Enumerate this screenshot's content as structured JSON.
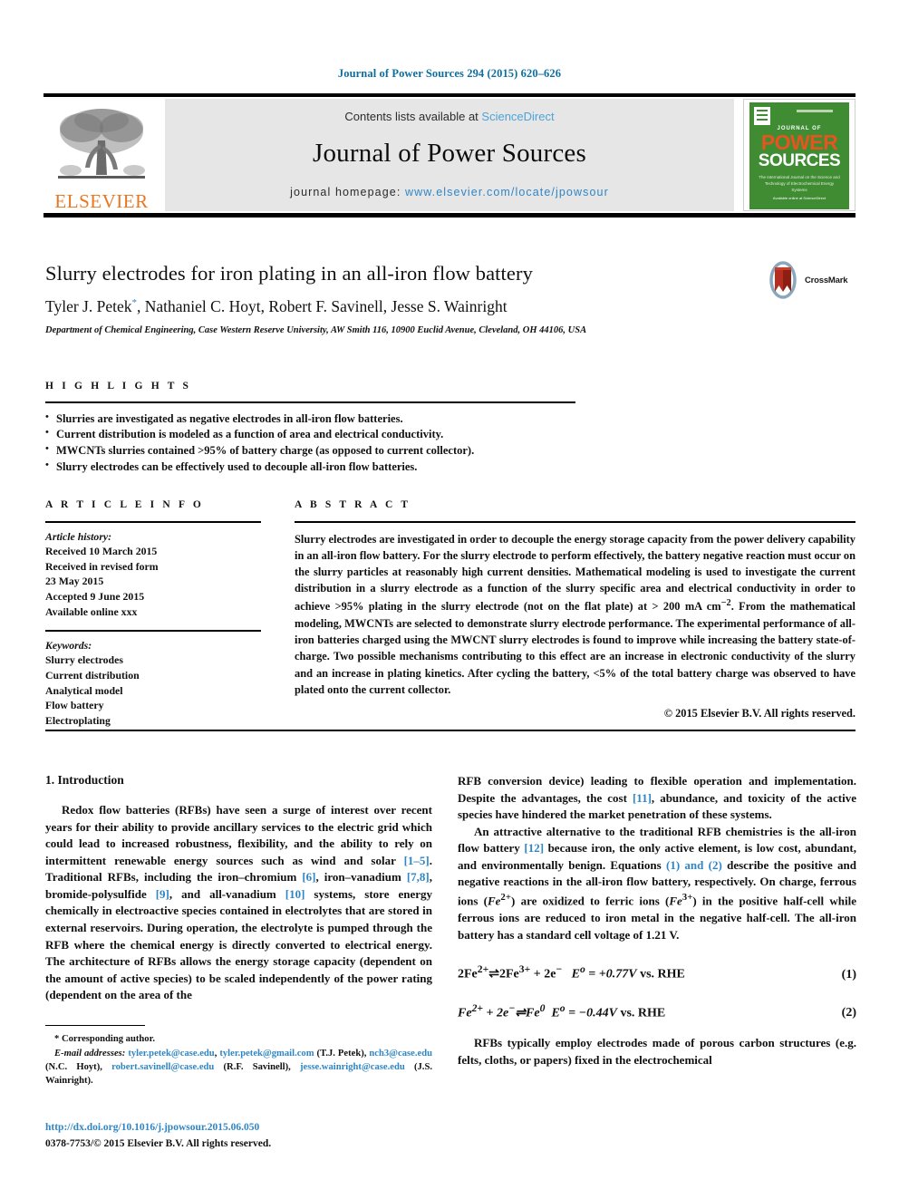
{
  "running_head": "Journal of Power Sources 294 (2015) 620–626",
  "masthead": {
    "contents_prefix": "Contents lists available at ",
    "sciencedirect": "ScienceDirect",
    "journal_title": "Journal of Power Sources",
    "homepage_prefix": "journal homepage: ",
    "homepage_url": "www.elsevier.com/locate/jpowsour",
    "publisher_wordmark": "ELSEVIER",
    "cover": {
      "journal_of": "JOURNAL OF",
      "power": "POWER",
      "sources": "SOURCES",
      "subtitle": "The International Journal on the Science and Technology of Electrochemical Energy Systems",
      "footer": "Available online at\nScienceDirect"
    },
    "accent_link_color": "#4ea3d8",
    "elsevier_orange": "#E87722",
    "cover_green": "#3f8c33"
  },
  "article": {
    "title": "Slurry electrodes for iron plating in an all-iron flow battery",
    "authors": "Tyler J. Petek, Nathaniel C. Hoyt, Robert F. Savinell, Jesse S. Wainright",
    "corresponding_marker": "*",
    "affiliation": "Department of Chemical Engineering, Case Western Reserve University, AW Smith 116, 10900 Euclid Avenue, Cleveland, OH 44106, USA",
    "crossmark_label": "CrossMark"
  },
  "highlights": {
    "heading": "H I G H L I G H T S",
    "items": [
      "Slurries are investigated as negative electrodes in all-iron flow batteries.",
      "Current distribution is modeled as a function of area and electrical conductivity.",
      "MWCNTs slurries contained >95% of battery charge (as opposed to current collector).",
      "Slurry electrodes can be effectively used to decouple all-iron flow batteries."
    ]
  },
  "article_info": {
    "heading": "A R T I C L E  I N F O",
    "history_label": "Article history:",
    "history": [
      "Received 10 March 2015",
      "Received in revised form",
      "23 May 2015",
      "Accepted 9 June 2015",
      "Available online xxx"
    ],
    "keywords_label": "Keywords:",
    "keywords": [
      "Slurry electrodes",
      "Current distribution",
      "Analytical model",
      "Flow battery",
      "Electroplating"
    ]
  },
  "abstract": {
    "heading": "A B S T R A C T",
    "text_part1": "Slurry electrodes are investigated in order to decouple the energy storage capacity from the power delivery capability in an all-iron flow battery. For the slurry electrode to perform effectively, the battery negative reaction must occur on the slurry particles at reasonably high current densities. Mathematical modeling is used to investigate the current distribution in a slurry electrode as a function of the slurry specific area and electrical conductivity in order to achieve >95% plating in the slurry electrode (not on the flat plate) at > 200 mA cm",
    "superscript1": "−2",
    "text_part2": ". From the mathematical modeling, MWCNTs are selected to demonstrate slurry electrode performance. The experimental performance of all-iron batteries charged using the MWCNT slurry electrodes is found to improve while increasing the battery state-of-charge. Two possible mechanisms contributing to this effect are an increase in electronic conductivity of the slurry and an increase in plating kinetics. After cycling the battery, <5% of the total battery charge was observed to have plated onto the current collector.",
    "copyright": "© 2015 Elsevier B.V. All rights reserved."
  },
  "body": {
    "section1_title": "1.  Introduction",
    "left_p1_a": "Redox flow batteries (RFBs) have seen a surge of interest over recent years for their ability to provide ancillary services to the electric grid which could lead to increased robustness, flexibility, and the ability to rely on intermittent renewable energy sources such as wind and solar ",
    "ref_1_5": "[1–5]",
    "left_p1_b": ". Traditional RFBs, including the iron–chromium ",
    "ref_6": "[6]",
    "left_p1_c": ", iron–vanadium ",
    "ref_78": "[7,8]",
    "left_p1_d": ", bromide-polysulfide ",
    "ref_9": "[9]",
    "left_p1_e": ", and all-vanadium ",
    "ref_10": "[10]",
    "left_p1_f": " systems, store energy chemically in electroactive species contained in electrolytes that are stored in external reservoirs. During operation, the electrolyte is pumped through the RFB where the chemical energy is directly converted to electrical energy. The architecture of RFBs allows the energy storage capacity (dependent on the amount of active species) to be scaled independently of the power rating (dependent on the area of the",
    "right_p1_a": "RFB conversion device) leading to flexible operation and implementation. Despite the advantages, the cost ",
    "ref_11": "[11]",
    "right_p1_b": ", abundance, and toxicity of the active species have hindered the market penetration of these systems.",
    "right_p2_a": "An attractive alternative to the traditional RFB chemistries is the all-iron flow battery ",
    "ref_12": "[12]",
    "right_p2_b": " because iron, the only active element, is low cost, abundant, and environmentally benign. Equations ",
    "ref_eq1and": "(1) and",
    "ref_eq2": "(2)",
    "right_p2_c": " describe the positive and negative reactions in the all-iron flow battery, respectively. On charge, ferrous ions (",
    "fe2_italic": "Fe",
    "fe2_sup": "2+",
    "right_p2_d": ") are oxidized to ferric ions (",
    "fe3_italic": "Fe",
    "fe3_sup": "3+",
    "right_p2_e": ") in the positive half-cell while ferrous ions are reduced to iron metal in the negative half-cell. The all-iron battery has a standard cell voltage of 1.21 V.",
    "right_p3": "RFBs typically employ electrodes made of porous carbon structures (e.g. felts, cloths, or papers) fixed in the electrochemical"
  },
  "equations": [
    {
      "lhs": "2Fe",
      "lhs_sup": "2+",
      "mid": "⇌2Fe",
      "mid_sup": "3+",
      "tail": " + 2e",
      "tail_sup": "−",
      "potential_symbol": "E",
      "potential_sup": "o",
      "potential_value": " = +0.77V",
      "reference": " vs. RHE",
      "number": "(1)"
    },
    {
      "lhs": "Fe",
      "lhs_sup": "2+",
      "mid": " + 2e",
      "mid_sup": "−",
      "tail": "⇌Fe",
      "tail_sup": "0",
      "potential_symbol": "E",
      "potential_sup": "o",
      "potential_value": " = −0.44V",
      "reference": " vs.  RHE",
      "number": "(2)"
    }
  ],
  "footnote": {
    "corresponding": "* Corresponding author.",
    "email_label": "E-mail addresses:",
    "emails": [
      {
        "addr": "tyler.petek@case.edu",
        "sep": ", "
      },
      {
        "addr": "tyler.petek@gmail.com",
        "sep": " (T.J. Petek), "
      },
      {
        "addr": "nch3@case.edu",
        "sep": " (N.C. Hoyt), "
      },
      {
        "addr": "robert.savinell@case.edu",
        "sep": " (R.F. Savinell), "
      },
      {
        "addr": "jesse.wainright@case.edu",
        "sep": " (J.S. Wainright)."
      }
    ],
    "doi": "http://dx.doi.org/10.1016/j.jpowsour.2015.06.050",
    "issn": "0378-7753/© 2015 Elsevier B.V. All rights reserved."
  }
}
